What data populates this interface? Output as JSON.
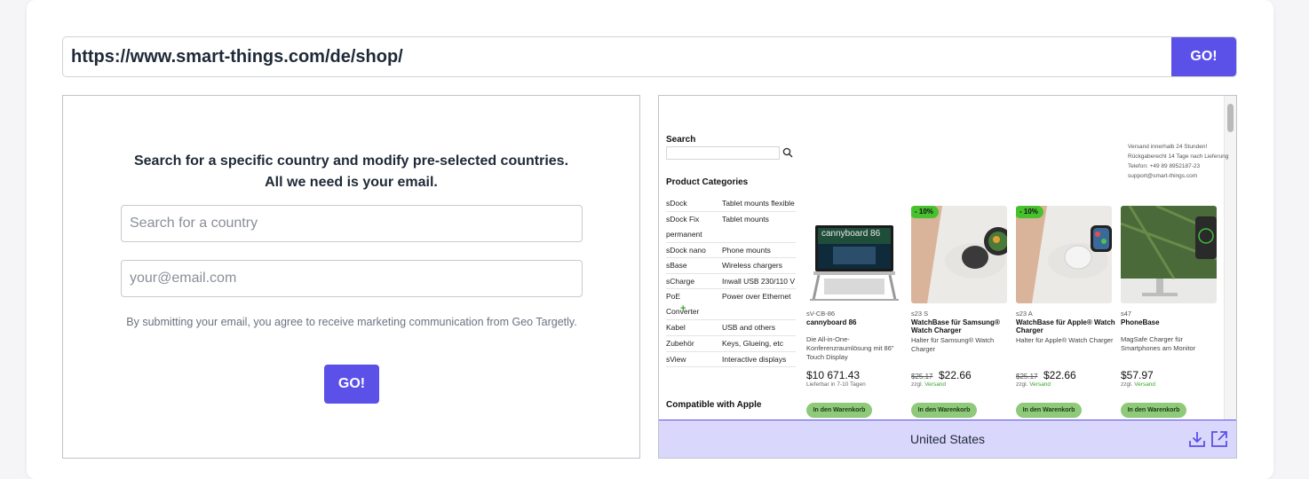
{
  "url_bar": {
    "value": "https://www.smart-things.com/de/shop/",
    "go_label": "GO!"
  },
  "form": {
    "headline_line1": "Search for a specific country and modify pre-selected countries.",
    "headline_line2": "All we need is your email.",
    "country_placeholder": "Search for a country",
    "email_placeholder": "your@email.com",
    "consent": "By submitting your email, you agree to receive marketing communication from Geo Targetly.",
    "go_label": "GO!"
  },
  "preview": {
    "search_label": "Search",
    "categories_label": "Product Categories",
    "categories": [
      {
        "name": "sDock",
        "desc": "Tablet mounts flexible"
      },
      {
        "name": "sDock Fix",
        "desc": "Tablet mounts",
        "name2": "permanent"
      },
      {
        "name": "sDock nano",
        "desc": "Phone mounts"
      },
      {
        "name": "sBase",
        "desc": "Wireless chargers"
      },
      {
        "name": "sCharge",
        "desc": "Inwall USB 230/110 V"
      },
      {
        "name": "PoE",
        "desc": "Power over Ethernet",
        "name2": "Converter"
      },
      {
        "name": "Kabel",
        "desc": "USB and others"
      },
      {
        "name": "Zubehör",
        "desc": "Keys, Glueing, etc"
      },
      {
        "name": "sView",
        "desc": "Interactive displays"
      }
    ],
    "compatible_label": "Compatible with Apple",
    "contact": [
      "Versand innerhalb 24 Stunden!",
      "Rückgaberecht 14 Tage nach Lieferung",
      "Telefon: +49 89 8952187-23",
      "support@smart-things.com"
    ],
    "products": [
      {
        "sku": "sV-CB-86",
        "name": "cannyboard 86",
        "desc": "Die All-in-One-Konferenzraumlösung mit 86\" Touch Display",
        "price": "$10 671.43",
        "note": "Lieferbar in 7-10 Tagen",
        "screen_text": "cannyboard 86",
        "cart": "In den Warenkorb"
      },
      {
        "badge": "- 10%",
        "sku": "s23 S",
        "name": "WatchBase für Samsung® Watch Charger",
        "desc": "Halter für Samsung® Watch Charger",
        "old_price": "$25.17",
        "price": "$22.66",
        "note_prefix": "zzgl.",
        "note_link": "Versand",
        "cart": "In den Warenkorb"
      },
      {
        "badge": "- 10%",
        "sku": "s23 A",
        "name": "WatchBase für Apple® Watch Charger",
        "desc": "Halter für Apple® Watch Charger",
        "old_price": "$25.17",
        "price": "$22.66",
        "note_prefix": "zzgl.",
        "note_link": "Versand",
        "cart": "In den Warenkorb"
      },
      {
        "sku": "s47",
        "name": "PhoneBase",
        "desc": "MagSafe Charger für Smartphones am Monitor",
        "price": "$57.97",
        "note_prefix": "zzgl.",
        "note_link": "Versand",
        "cart": "In den Warenkorb"
      }
    ],
    "footer_country": "United States"
  },
  "colors": {
    "accent": "#5b50e8",
    "footer_bg": "#d9d7fb",
    "badge_green": "#47c22e",
    "cart_green": "#8fc97a"
  },
  "icons": [
    "search-icon",
    "download-icon",
    "open-external-icon"
  ]
}
